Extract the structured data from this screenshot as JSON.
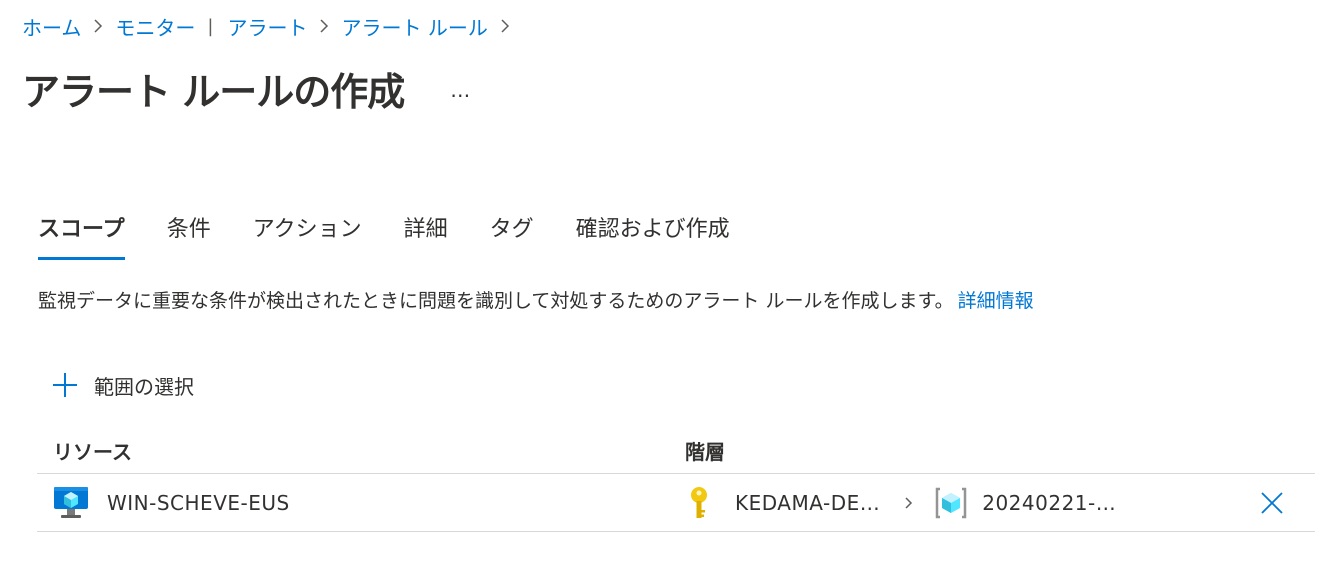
{
  "breadcrumb": {
    "home": "ホーム",
    "monitor": "モニター",
    "alerts": "アラート",
    "alert_rules": "アラート ルール"
  },
  "header": {
    "title": "アラート ルールの作成",
    "more": "…"
  },
  "tabs": [
    {
      "label": "スコープ",
      "active": true
    },
    {
      "label": "条件",
      "active": false
    },
    {
      "label": "アクション",
      "active": false
    },
    {
      "label": "詳細",
      "active": false
    },
    {
      "label": "タグ",
      "active": false
    },
    {
      "label": "確認および作成",
      "active": false
    }
  ],
  "scope": {
    "description": "監視データに重要な条件が検出されたときに問題を識別して対処するためのアラート ルールを作成します。",
    "learn_more": "詳細情報",
    "select_scope_label": "範囲の選択",
    "table": {
      "columns": [
        "リソース",
        "階層"
      ],
      "rows": [
        {
          "resource": "WIN-SCHEVE-EUS",
          "resource_icon": "virtual-machine-icon",
          "subscription": "KEDAMA-DE…",
          "subscription_icon": "key-icon",
          "resource_group": "20240221-…",
          "resource_group_icon": "resource-group-icon"
        }
      ]
    }
  },
  "colors": {
    "accent": "#0078d4",
    "text": "#323130",
    "border": "#d8d8d8",
    "key": "#f2c811"
  }
}
